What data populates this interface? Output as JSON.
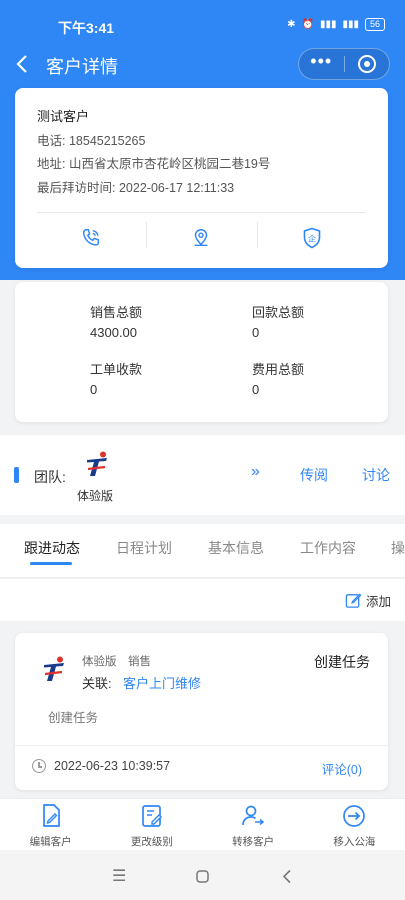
{
  "status_bar": {
    "time": "下午3:41",
    "battery": "56"
  },
  "nav": {
    "title": "客户详情"
  },
  "customer": {
    "name": "测试客户",
    "phone_label": "电话:",
    "phone": "18545215265",
    "address_label": "地址:",
    "address": "山西省太原市杏花岭区桃园二巷19号",
    "last_visit_label": "最后拜访时间:",
    "last_visit": "2022-06-17 12:11:33"
  },
  "stats": {
    "sales_total_label": "销售总额",
    "sales_total": "4300.00",
    "refund_total_label": "回款总额",
    "refund_total": "0",
    "work_order_label": "工单收款",
    "work_order": "0",
    "expense_label": "费用总额",
    "expense": "0"
  },
  "team": {
    "label": "团队:",
    "member_name": "体验版",
    "circulate": "传阅",
    "discuss": "讨论"
  },
  "tabs": [
    {
      "label": "跟进动态"
    },
    {
      "label": "日程计划"
    },
    {
      "label": "基本信息"
    },
    {
      "label": "工作内容"
    },
    {
      "label": "操"
    }
  ],
  "add_label": "添加",
  "feed": {
    "author": "体验版",
    "dept": "销售",
    "relation_label": "关联:",
    "relation_value": "客户上门维修",
    "type": "创建任务",
    "content": "创建任务",
    "time": "2022-06-23 10:39:57",
    "comment": "评论(0)"
  },
  "bottom_actions": [
    {
      "label": "编辑客户"
    },
    {
      "label": "更改级别"
    },
    {
      "label": "转移客户"
    },
    {
      "label": "移入公海"
    }
  ],
  "colors": {
    "primary": "#2f86f5",
    "logo_blue": "#1a3a8c",
    "logo_red": "#e0322c"
  }
}
